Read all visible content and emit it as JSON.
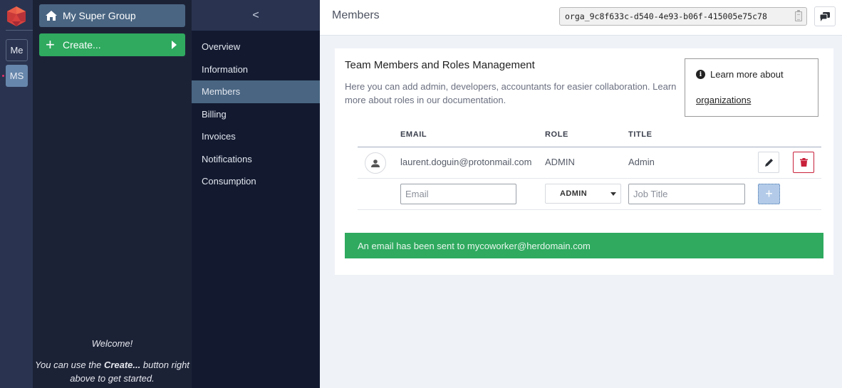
{
  "rail": {
    "logo": "hexagon-logo",
    "orgs": [
      {
        "label": "Me",
        "active": false
      },
      {
        "label": "MS",
        "active": true
      }
    ]
  },
  "sidebar": {
    "group_name": "My Super Group",
    "group_icon": "home-icon",
    "create_label": "Create...",
    "welcome_title": "Welcome!",
    "welcome_text_pre": "You can use the ",
    "welcome_text_bold": "Create...",
    "welcome_text_post": " button right above to get started."
  },
  "section_nav": {
    "collapse_glyph": "<",
    "items": [
      {
        "label": "Overview",
        "active": false
      },
      {
        "label": "Information",
        "active": false
      },
      {
        "label": "Members",
        "active": true
      },
      {
        "label": "Billing",
        "active": false
      },
      {
        "label": "Invoices",
        "active": false
      },
      {
        "label": "Notifications",
        "active": false
      },
      {
        "label": "Consumption",
        "active": false
      }
    ]
  },
  "header": {
    "title": "Members",
    "org_id": "orga_9c8f633c-d540-4e93-b06f-415005e75c78"
  },
  "card": {
    "title": "Team Members and Roles Management",
    "description": "Here you can add admin, developers, accountants for easier collaboration. Learn more about roles in our documentation.",
    "learn_more": {
      "text": "Learn more about",
      "link": "organizations"
    },
    "table": {
      "headers": {
        "email": "EMAIL",
        "role": "ROLE",
        "title": "TITLE"
      },
      "rows": [
        {
          "email": "laurent.doguin@protonmail.com",
          "role": "ADMIN",
          "title": "Admin"
        }
      ],
      "new_row": {
        "email_placeholder": "Email",
        "email_value": "",
        "role_selected": "ADMIN",
        "title_placeholder": "Job Title",
        "title_value": "",
        "add_label": "+"
      }
    },
    "alert": "An email has been sent to mycoworker@herdomain.com"
  },
  "colors": {
    "success": "#2faa5f",
    "sidebar_active": "#496582",
    "danger": "#c8203a",
    "brand": "#e24a4a"
  }
}
